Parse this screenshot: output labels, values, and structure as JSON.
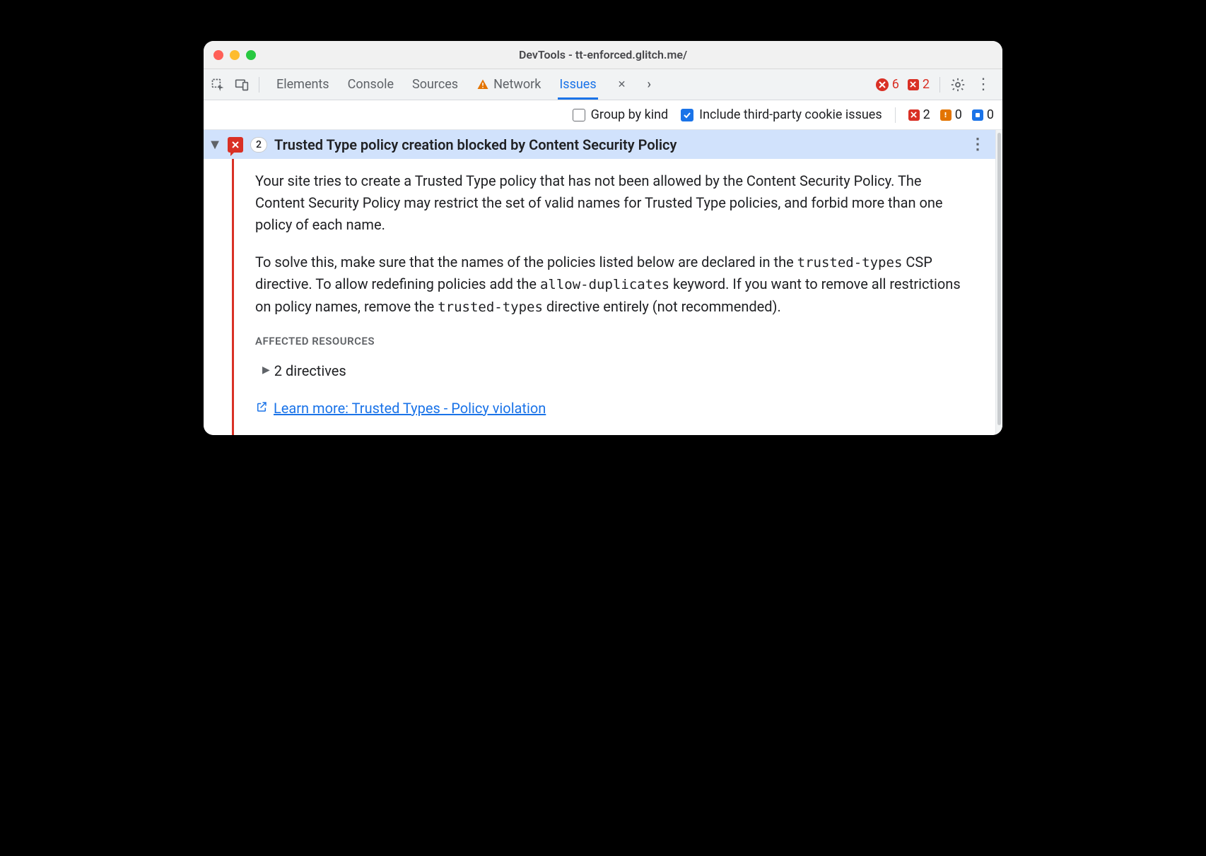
{
  "window": {
    "title": "DevTools - tt-enforced.glitch.me/"
  },
  "tabs": {
    "items": [
      "Elements",
      "Console",
      "Sources",
      "Network",
      "Issues"
    ],
    "active": "Issues",
    "errorCount": "6",
    "issueCount": "2"
  },
  "filters": {
    "groupByKind": "Group by kind",
    "includeThirdParty": "Include third-party cookie issues",
    "counts": {
      "errors": "2",
      "warnings": "0",
      "info": "0"
    }
  },
  "issue": {
    "count": "2",
    "title": "Trusted Type policy creation blocked by Content Security Policy",
    "para1": "Your site tries to create a Trusted Type policy that has not been allowed by the Content Security Policy. The Content Security Policy may restrict the set of valid names for Trusted Type policies, and forbid more than one policy of each name.",
    "para2a": "To solve this, make sure that the names of the policies listed below are declared in the ",
    "code1": "trusted-types",
    "para2b": " CSP directive. To allow redefining policies add the ",
    "code2": "allow-duplicates",
    "para2c": " keyword. If you want to remove all restrictions on policy names, remove the ",
    "code3": "trusted-types",
    "para2d": " directive entirely (not recommended).",
    "affectedLabel": "AFFECTED RESOURCES",
    "directives": "2 directives",
    "learnMore": "Learn more: Trusted Types - Policy violation"
  }
}
